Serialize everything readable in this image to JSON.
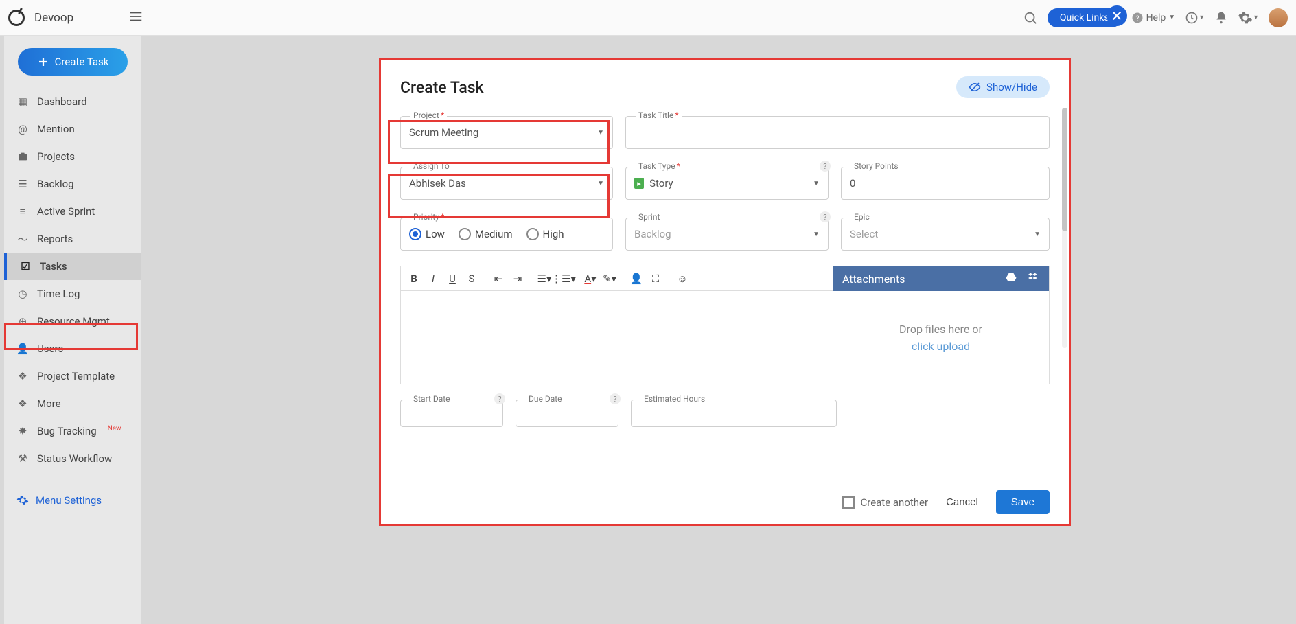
{
  "brand": "Devoop",
  "topbar": {
    "quick_links": "Quick Links",
    "help": "Help"
  },
  "sidebar": {
    "create_task": "Create Task",
    "items": [
      {
        "label": "Dashboard"
      },
      {
        "label": "Mention"
      },
      {
        "label": "Projects"
      },
      {
        "label": "Backlog"
      },
      {
        "label": "Active Sprint"
      },
      {
        "label": "Reports"
      },
      {
        "label": "Tasks"
      },
      {
        "label": "Time Log"
      },
      {
        "label": "Resource Mgmt"
      },
      {
        "label": "Users"
      },
      {
        "label": "Project Template"
      },
      {
        "label": "More"
      },
      {
        "label": "Bug Tracking"
      },
      {
        "label": "Status Workflow"
      }
    ],
    "bug_tracking_badge": "New",
    "menu_settings": "Menu Settings"
  },
  "dialog": {
    "title": "Create Task",
    "showhide": "Show/Hide",
    "fields": {
      "project": {
        "label": "Project",
        "value": "Scrum Meeting"
      },
      "task_title": {
        "label": "Task Title",
        "value": ""
      },
      "assign_to": {
        "label": "Assign To",
        "value": "Abhisek Das"
      },
      "task_type": {
        "label": "Task Type",
        "value": "Story"
      },
      "story_points": {
        "label": "Story Points",
        "value": "0"
      },
      "priority": {
        "label": "Priority",
        "options": [
          "Low",
          "Medium",
          "High"
        ],
        "selected": "Low"
      },
      "sprint": {
        "label": "Sprint",
        "value": "Backlog"
      },
      "epic": {
        "label": "Epic",
        "value": "Select"
      },
      "start_date": {
        "label": "Start Date"
      },
      "due_date": {
        "label": "Due Date"
      },
      "estimated_hours": {
        "label": "Estimated Hours"
      }
    },
    "attachments": {
      "header": "Attachments",
      "drop_text": "Drop files here or",
      "upload_link": "click upload"
    },
    "footer": {
      "create_another": "Create another",
      "cancel": "Cancel",
      "save": "Save"
    }
  }
}
